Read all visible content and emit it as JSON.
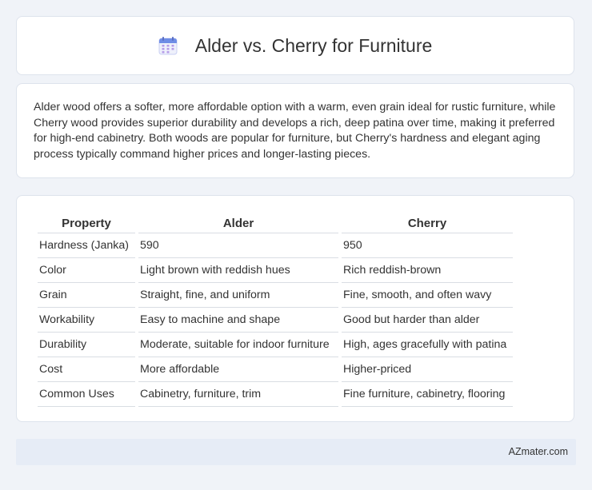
{
  "header": {
    "title": "Alder vs. Cherry for Furniture",
    "icon": "calendar-icon"
  },
  "description": "Alder wood offers a softer, more affordable option with a warm, even grain ideal for rustic furniture, while Cherry wood provides superior durability and develops a rich, deep patina over time, making it preferred for high-end cabinetry. Both woods are popular for furniture, but Cherry's hardness and elegant aging process typically command higher prices and longer-lasting pieces.",
  "table": {
    "headers": [
      "Property",
      "Alder",
      "Cherry"
    ],
    "rows": [
      [
        "Hardness (Janka)",
        "590",
        "950"
      ],
      [
        "Color",
        "Light brown with reddish hues",
        "Rich reddish-brown"
      ],
      [
        "Grain",
        "Straight, fine, and uniform",
        "Fine, smooth, and often wavy"
      ],
      [
        "Workability",
        "Easy to machine and shape",
        "Good but harder than alder"
      ],
      [
        "Durability",
        "Moderate, suitable for indoor furniture",
        "High, ages gracefully with patina"
      ],
      [
        "Cost",
        "More affordable",
        "Higher-priced"
      ],
      [
        "Common Uses",
        "Cabinetry, furniture, trim",
        "Fine furniture, cabinetry, flooring"
      ]
    ]
  },
  "footer": {
    "text": "AZmater.com"
  },
  "colors": {
    "background": "#f0f3f8",
    "card": "#ffffff",
    "footer": "#e6ecf6",
    "icon_accent": "#7b8ee8"
  }
}
